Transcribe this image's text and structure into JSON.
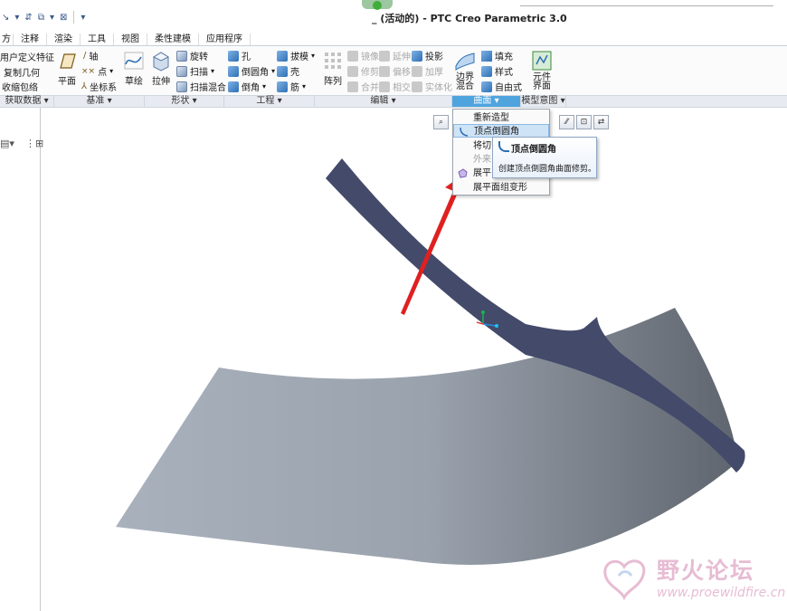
{
  "window": {
    "title": "_ (活动的) - PTC Creo Parametric 3.0"
  },
  "quick_access": {
    "items": [
      "↘",
      "▾",
      "⇵",
      "⧉",
      "▾",
      "⊠",
      "▾"
    ]
  },
  "tabs": [
    "方",
    "注释",
    "渲染",
    "工具",
    "视图",
    "柔性建模",
    "应用程序"
  ],
  "ribbon": {
    "get_data": [
      "用户定义特征",
      "复制几何",
      "收缩包络"
    ],
    "datum": {
      "plane": "平面",
      "axis": "轴",
      "point": "点",
      "csys": "坐标系",
      "sketch": "草绘"
    },
    "shapes": {
      "extrude": "拉伸",
      "revolve": "旋转",
      "sweep": "扫描",
      "swept_blend": "扫描混合"
    },
    "engineering": {
      "hole": "孔",
      "round": "倒圆角",
      "chamfer": "倒角",
      "draft": "拔模",
      "shell": "壳",
      "rib": "筋"
    },
    "editing": {
      "pattern": "阵列",
      "mirror": "镜像",
      "extend": "延伸",
      "project": "投影",
      "trim": "修剪",
      "offset": "偏移",
      "thicken": "加厚",
      "merge": "合并",
      "intersect": "相交",
      "solidify": "实体化"
    },
    "surfaces": {
      "boundary_blend": "边界混合",
      "fill": "填充",
      "style": "样式",
      "freestyle": "自由式"
    },
    "model_intent": {
      "component_interface": "元件界面"
    }
  },
  "group_labels": {
    "get_data": "获取数据 ▾",
    "datum": "基准 ▾",
    "shapes": "形状 ▾",
    "engineering": "工程 ▾",
    "editing": "编辑 ▾",
    "surfaces": "曲面 ▾",
    "model_intent": "模型意图 ▾"
  },
  "dropdown": {
    "items": [
      {
        "label": "重新造型",
        "state": "normal"
      },
      {
        "label": "顶点倒圆角",
        "state": "highlight"
      },
      {
        "label": "将切",
        "state": "normal"
      },
      {
        "label": "外来",
        "state": "disabled"
      },
      {
        "label": "展平",
        "state": "normal"
      },
      {
        "label": "展平面组变形",
        "state": "normal"
      }
    ]
  },
  "tooltip": {
    "title": "顶点倒圆角",
    "description": "创建顶点倒圆角曲面修剪。"
  },
  "watermark": {
    "title": "野火论坛",
    "url": "www.proewildfire.cn"
  },
  "colors": {
    "accent": "#4fa4de",
    "upper_surface": "#434a6a",
    "lower_surface_light": "#a9b1bd",
    "lower_surface_dark": "#5f656e",
    "arrow": "#e02020",
    "watermark": "#e7bcd3"
  }
}
